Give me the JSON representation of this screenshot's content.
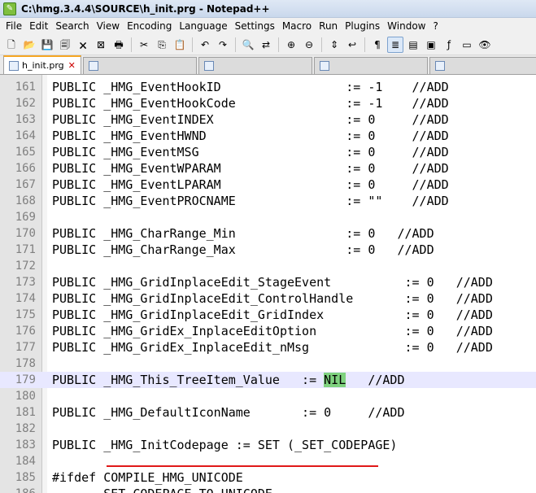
{
  "window": {
    "title": "C:\\hmg.3.4.4\\SOURCE\\h_init.prg - Notepad++",
    "icon": "notepadpp-icon"
  },
  "menu": [
    "File",
    "Edit",
    "Search",
    "View",
    "Encoding",
    "Language",
    "Settings",
    "Macro",
    "Run",
    "Plugins",
    "Window",
    "?"
  ],
  "toolbar": {
    "buttons": [
      {
        "name": "new-file",
        "glyph": "🗋"
      },
      {
        "name": "open-file",
        "glyph": "📂"
      },
      {
        "name": "save",
        "glyph": "💾"
      },
      {
        "name": "save-all",
        "glyph": "🗐"
      },
      {
        "name": "close",
        "glyph": "🗙"
      },
      {
        "name": "close-all",
        "glyph": "⊠"
      },
      {
        "name": "print",
        "glyph": "🖶"
      },
      {
        "name": "cut",
        "glyph": "✂"
      },
      {
        "name": "copy",
        "glyph": "⎘"
      },
      {
        "name": "paste",
        "glyph": "📋"
      },
      {
        "name": "undo",
        "glyph": "↶"
      },
      {
        "name": "redo",
        "glyph": "↷"
      },
      {
        "name": "find",
        "glyph": "🔍"
      },
      {
        "name": "replace",
        "glyph": "⇄"
      },
      {
        "name": "zoom-in",
        "glyph": "⊕"
      },
      {
        "name": "zoom-out",
        "glyph": "⊖"
      },
      {
        "name": "sync-vertical",
        "glyph": "⇕"
      },
      {
        "name": "word-wrap",
        "glyph": "↩"
      },
      {
        "name": "show-all-chars",
        "glyph": "¶"
      },
      {
        "name": "indent-guide",
        "glyph": "≣"
      },
      {
        "name": "user-language",
        "glyph": "▤"
      },
      {
        "name": "doc-map",
        "glyph": "▣"
      },
      {
        "name": "function-list",
        "glyph": "ƒ"
      },
      {
        "name": "folder-workspace",
        "glyph": "▭"
      },
      {
        "name": "monitoring",
        "glyph": "👁"
      }
    ]
  },
  "tabs": [
    {
      "label": "h_init.prg",
      "active": true
    },
    {
      "label": "",
      "active": false
    },
    {
      "label": "",
      "active": false
    },
    {
      "label": "",
      "active": false
    },
    {
      "label": "",
      "active": false
    }
  ],
  "editor": {
    "current_line": 179,
    "lines": [
      {
        "n": "161",
        "text": "PUBLIC _HMG_EventHookID                 := -1    //ADD"
      },
      {
        "n": "162",
        "text": "PUBLIC _HMG_EventHookCode               := -1    //ADD"
      },
      {
        "n": "163",
        "text": "PUBLIC _HMG_EventINDEX                  := 0     //ADD"
      },
      {
        "n": "164",
        "text": "PUBLIC _HMG_EventHWND                   := 0     //ADD"
      },
      {
        "n": "165",
        "text": "PUBLIC _HMG_EventMSG                    := 0     //ADD"
      },
      {
        "n": "166",
        "text": "PUBLIC _HMG_EventWPARAM                 := 0     //ADD"
      },
      {
        "n": "167",
        "text": "PUBLIC _HMG_EventLPARAM                 := 0     //ADD"
      },
      {
        "n": "168",
        "text": "PUBLIC _HMG_EventPROCNAME               := \"\"    //ADD"
      },
      {
        "n": "169",
        "text": ""
      },
      {
        "n": "170",
        "text": "PUBLIC _HMG_CharRange_Min               := 0   //ADD"
      },
      {
        "n": "171",
        "text": "PUBLIC _HMG_CharRange_Max               := 0   //ADD"
      },
      {
        "n": "172",
        "text": ""
      },
      {
        "n": "173",
        "text": "PUBLIC _HMG_GridInplaceEdit_StageEvent          := 0   //ADD"
      },
      {
        "n": "174",
        "text": "PUBLIC _HMG_GridInplaceEdit_ControlHandle       := 0   //ADD"
      },
      {
        "n": "175",
        "text": "PUBLIC _HMG_GridInplaceEdit_GridIndex           := 0   //ADD"
      },
      {
        "n": "176",
        "text": "PUBLIC _HMG_GridEx_InplaceEditOption            := 0   //ADD"
      },
      {
        "n": "177",
        "text": "PUBLIC _HMG_GridEx_InplaceEdit_nMsg             := 0   //ADD"
      },
      {
        "n": "178",
        "text": ""
      },
      {
        "n": "179",
        "text": "PUBLIC _HMG_This_TreeItem_Value   := ",
        "highlight": "NIL",
        "after": "   //ADD"
      },
      {
        "n": "180",
        "text": ""
      },
      {
        "n": "181",
        "text": "PUBLIC _HMG_DefaultIconName       := 0     //ADD"
      },
      {
        "n": "182",
        "text": ""
      },
      {
        "n": "183",
        "text": "PUBLIC _HMG_InitCodepage := SET (_SET_CODEPAGE)"
      },
      {
        "n": "184",
        "text": ""
      },
      {
        "n": "185",
        "text": "#ifdef COMPILE_HMG_UNICODE"
      },
      {
        "n": "186",
        "text": "       SET CODEPAGE TO UNICODE"
      }
    ]
  }
}
